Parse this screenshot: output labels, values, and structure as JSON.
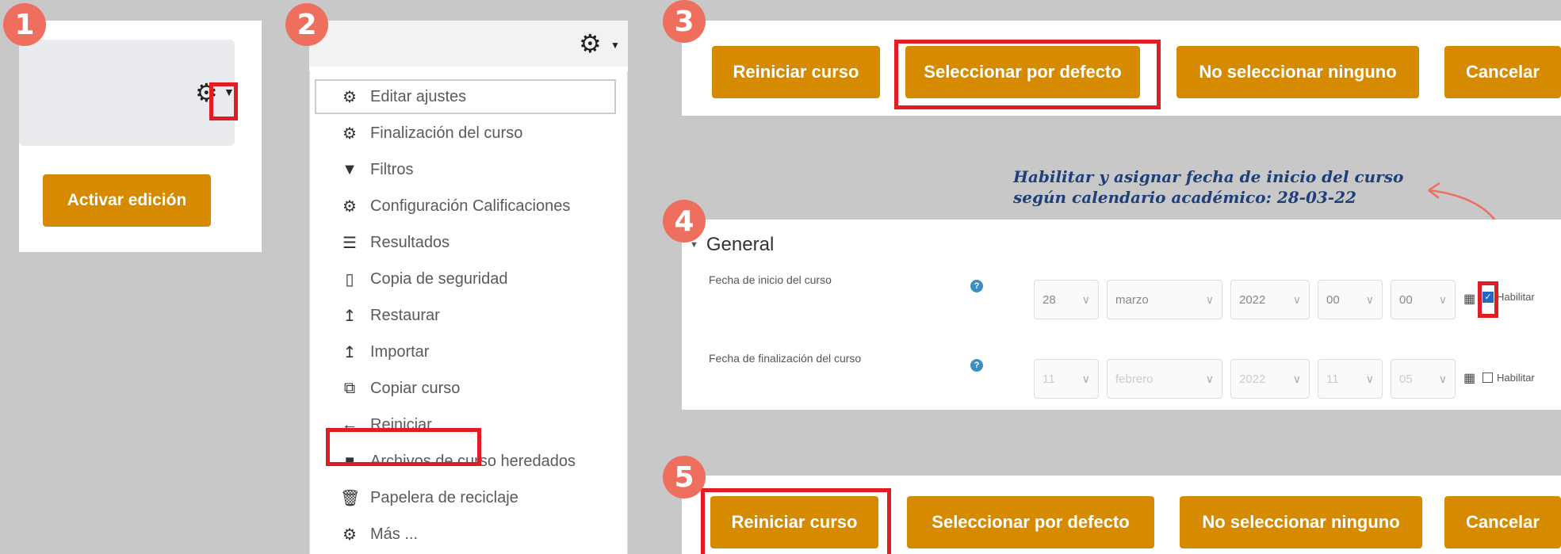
{
  "badges": [
    "1",
    "2",
    "3",
    "4",
    "5"
  ],
  "panel1": {
    "button_label": "Activar edición",
    "icons": [
      "gear-icon",
      "caret-down-icon"
    ]
  },
  "panel2": {
    "menu_items": [
      {
        "label": "Editar ajustes",
        "icon": "gear-icon"
      },
      {
        "label": "Finalización del curso",
        "icon": "gear-icon"
      },
      {
        "label": "Filtros",
        "icon": "filter-icon"
      },
      {
        "label": "Configuración Calificaciones",
        "icon": "gear-icon"
      },
      {
        "label": "Resultados",
        "icon": "list-icon"
      },
      {
        "label": "Copia de seguridad",
        "icon": "file-icon"
      },
      {
        "label": "Restaurar",
        "icon": "upload-icon"
      },
      {
        "label": "Importar",
        "icon": "upload-icon"
      },
      {
        "label": "Copiar curso",
        "icon": "copy-icon"
      },
      {
        "label": "Reiniciar",
        "icon": "arrow-left-icon"
      },
      {
        "label": "Archivos de curso heredados",
        "icon": "folder-icon"
      },
      {
        "label": "Papelera de reciclaje",
        "icon": "trash-icon"
      },
      {
        "label": "Más ...",
        "icon": "gear-icon"
      }
    ]
  },
  "panel3": {
    "buttons": [
      "Reiniciar curso",
      "Seleccionar por defecto",
      "No seleccionar ninguno",
      "Cancelar"
    ]
  },
  "annotation": {
    "line1": "Habilitar y asignar fecha de inicio del curso",
    "line2": "según calendario académico: 28-03-22"
  },
  "panel4": {
    "section_title": "General",
    "start": {
      "label": "Fecha de inicio del curso",
      "day": "28",
      "month": "marzo",
      "year": "2022",
      "hour": "00",
      "minute": "00",
      "enable_label": "Habilitar",
      "enabled": true
    },
    "end": {
      "label": "Fecha de finalización del curso",
      "day": "11",
      "month": "febrero",
      "year": "2022",
      "hour": "11",
      "minute": "05",
      "enable_label": "Habilitar",
      "enabled": false
    }
  },
  "panel5": {
    "buttons": [
      "Reiniciar curso",
      "Seleccionar por defecto",
      "No seleccionar ninguno",
      "Cancelar"
    ]
  },
  "colors": {
    "accent": "#d58a00",
    "highlight": "#e31b23",
    "badge": "#ef6f5f",
    "annotation": "#1e3f7a"
  }
}
